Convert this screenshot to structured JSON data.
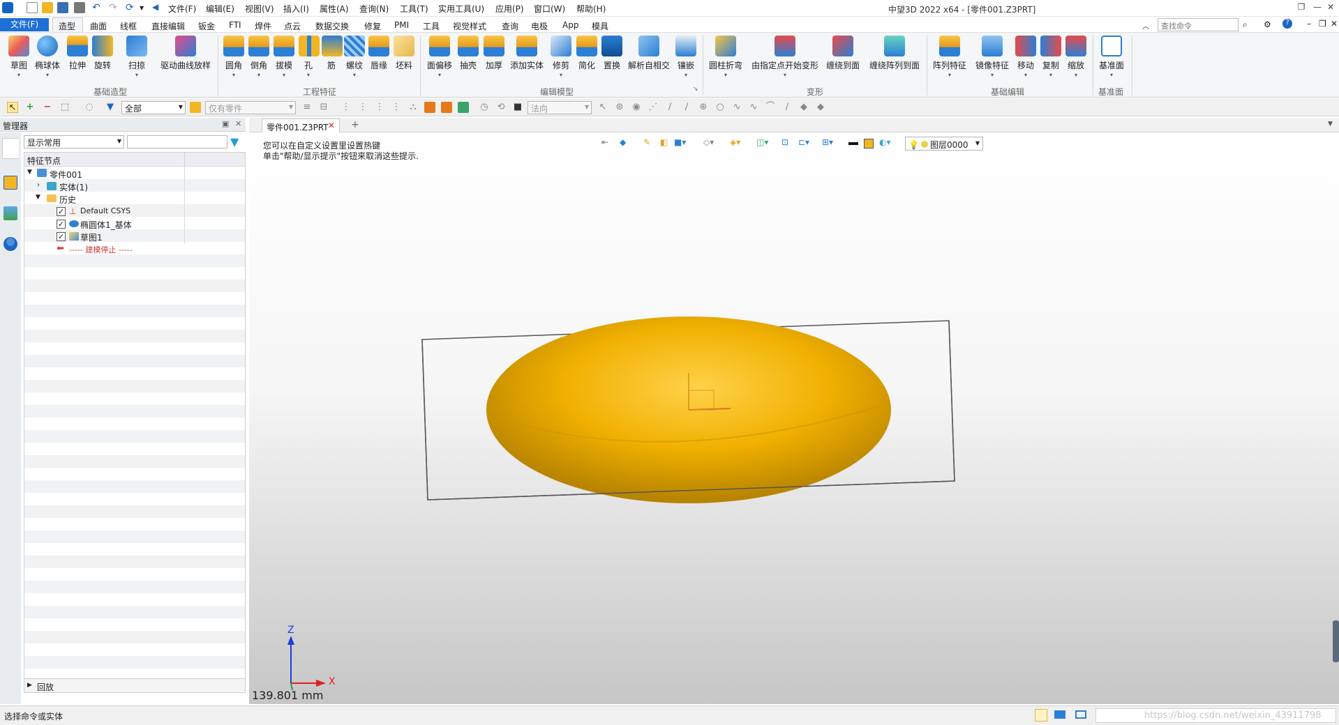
{
  "titlebar": {
    "title": "中望3D 2022 x64 - [零件001.Z3PRT]",
    "menus": [
      "文件(F)",
      "编辑(E)",
      "视图(V)",
      "插入(I)",
      "属性(A)",
      "查询(N)",
      "工具(T)",
      "实用工具(U)",
      "应用(P)",
      "窗口(W)",
      "帮助(H)"
    ]
  },
  "ribbon_tabs": {
    "file": "文件(F)",
    "tabs": [
      "造型",
      "曲面",
      "线框",
      "直接编辑",
      "钣金",
      "FTI",
      "焊件",
      "点云",
      "数据交换",
      "修复",
      "PMI",
      "工具",
      "视觉样式",
      "查询",
      "电极",
      "App",
      "模具"
    ],
    "search_placeholder": "查找命令"
  },
  "ribbon": {
    "groups": [
      "基础造型",
      "工程特征",
      "编辑模型",
      "变形",
      "基础编辑",
      "基准面"
    ],
    "buttons": [
      "草图",
      "椭球体",
      "拉伸",
      "旋转",
      "扫掠",
      "驱动曲线放样",
      "圆角",
      "倒角",
      "拔模",
      "孔",
      "筋",
      "螺纹",
      "唇缘",
      "坯料",
      "面偏移",
      "抽壳",
      "加厚",
      "添加实体",
      "修剪",
      "简化",
      "置换",
      "解析自相交",
      "镶嵌",
      "圆柱折弯",
      "由指定点开始变形",
      "缠绕到面",
      "缠绕阵列到面",
      "阵列特征",
      "镜像特征",
      "移动",
      "复制",
      "缩放",
      "基准面"
    ]
  },
  "toolbar": {
    "filter": "全部",
    "scope": "仅有零件",
    "direction": "法向"
  },
  "manager": {
    "title": "管理器",
    "display": "显示常用",
    "header": "特征节点",
    "tree": {
      "part": "零件001",
      "solid": "实体(1)",
      "history": "历史",
      "csys": "Default CSYS",
      "ellipsoid": "椭圆体1_基体",
      "sketch": "草图1",
      "stop": "----- 建模停止 -----"
    },
    "footer": "回放"
  },
  "doc": {
    "tab": "零件001.Z3PRT",
    "hint1": "您可以在自定义设置里设置热键",
    "hint2": "单击\"帮助/显示提示\"按钮来取消这些提示.",
    "layer": "图层0000",
    "measure": "139.801 mm",
    "axis_z": "Z",
    "axis_x": "X",
    "shape_color": "#f0b000"
  },
  "status": {
    "text": "选择命令或实体",
    "watermark": "https://blog.csdn.net/weixin_43911798"
  }
}
